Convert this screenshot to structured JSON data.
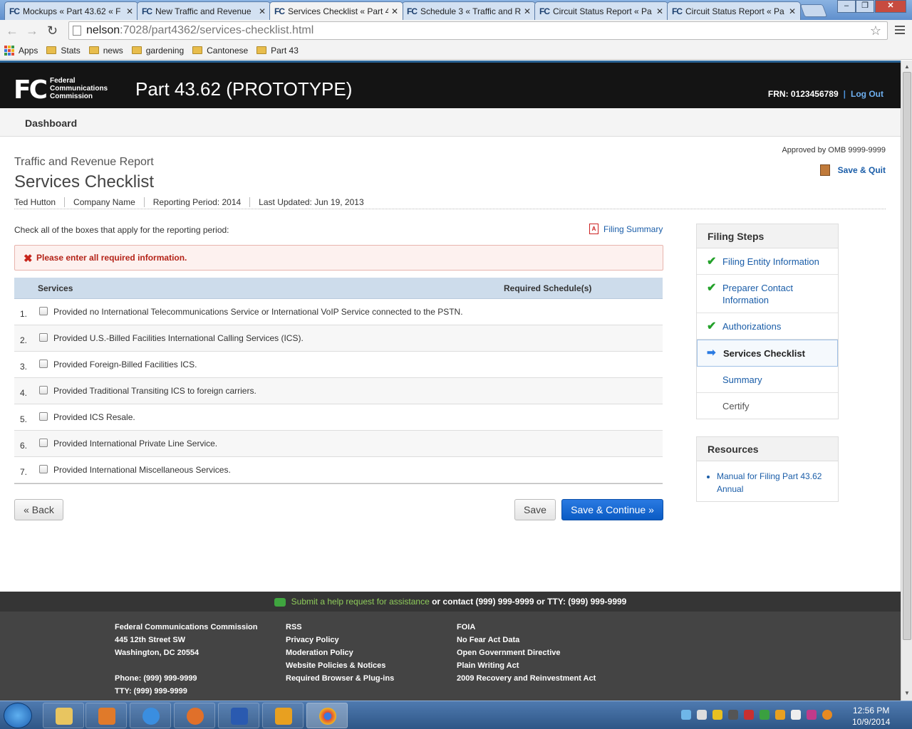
{
  "browser": {
    "tabs": [
      {
        "label": "Mockups « Part 43.62 « F",
        "favicon": "FC"
      },
      {
        "label": "New Traffic and Revenue",
        "favicon": "FC"
      },
      {
        "label": "Services Checklist « Part 4",
        "favicon": "FC"
      },
      {
        "label": "Schedule 3 « Traffic and R",
        "favicon": "FC"
      },
      {
        "label": "Circuit Status Report « Pa",
        "favicon": "FC"
      },
      {
        "label": "Circuit Status Report « Pa",
        "favicon": "FC"
      }
    ],
    "url_host": "nelson",
    "url_rest": ":7028/part4362/services-checklist.html",
    "bookmarks": [
      "Apps",
      "Stats",
      "news",
      "gardening",
      "Cantonese",
      "Part 43"
    ]
  },
  "header": {
    "logo": "FC",
    "agency_line1": "Federal",
    "agency_line2": "Communications",
    "agency_line3": "Commission",
    "title": "Part 43.62 (PROTOTYPE)",
    "frn": "FRN: 0123456789",
    "separator": "|",
    "logout": "Log Out"
  },
  "nav": {
    "dashboard": "Dashboard"
  },
  "page": {
    "omb": "Approved by OMB 9999-9999",
    "save_quit": "Save & Quit",
    "subtitle": "Traffic and Revenue Report",
    "title": "Services Checklist",
    "meta": [
      "Ted Hutton",
      "Company Name",
      "Reporting Period: 2014",
      "Last Updated: Jun 19, 2013"
    ],
    "instruction": "Check all of the boxes that apply for the reporting period:",
    "filing_summary": "Filing Summary",
    "error": "Please enter all required information.",
    "table_headers": {
      "services": "Services",
      "required": "Required Schedule(s)"
    },
    "services": [
      {
        "num": "1.",
        "text": "Provided no International Telecommunications Service or International VoIP Service connected to the PSTN."
      },
      {
        "num": "2.",
        "text": "Provided U.S.-Billed Facilities International Calling Services (ICS)."
      },
      {
        "num": "3.",
        "text": "Provided Foreign-Billed Facilities ICS."
      },
      {
        "num": "4.",
        "text": "Provided Traditional Transiting ICS to foreign carriers."
      },
      {
        "num": "5.",
        "text": "Provided ICS Resale."
      },
      {
        "num": "6.",
        "text": "Provided International Private Line Service."
      },
      {
        "num": "7.",
        "text": "Provided International Miscellaneous Services."
      }
    ],
    "back": "« Back",
    "save": "Save",
    "save_continue": "Save & Continue »"
  },
  "sidebar": {
    "steps_title": "Filing Steps",
    "steps": [
      {
        "label": "Filing Entity Information",
        "state": "done"
      },
      {
        "label": "Preparer Contact Information",
        "state": "done"
      },
      {
        "label": "Authorizations",
        "state": "done"
      },
      {
        "label": "Services Checklist",
        "state": "current"
      },
      {
        "label": "Summary",
        "state": "pending"
      },
      {
        "label": "Certify",
        "state": "disabled"
      }
    ],
    "resources_title": "Resources",
    "resources": [
      "Manual for Filing Part 43.62 Annual"
    ]
  },
  "footer": {
    "help_link": "Submit a help request for assistance",
    "help_rest": " or contact (999) 999-9999 or TTY: (999) 999-9999",
    "col1": [
      "Federal Communications Commission",
      "445 12th Street SW",
      "Washington, DC 20554",
      "",
      "Phone: (999) 999-9999",
      "TTY: (999) 999-9999"
    ],
    "col2": [
      "RSS",
      "Privacy Policy",
      "Moderation Policy",
      "Website Policies & Notices",
      "Required Browser & Plug-ins"
    ],
    "col3": [
      "FOIA",
      "No Fear Act Data",
      "Open Government Directive",
      "Plain Writing Act",
      "2009 Recovery and Reinvestment Act"
    ]
  },
  "taskbar": {
    "time": "12:56 PM",
    "date": "10/9/2014"
  },
  "colors": {
    "accent": "#0a5bc4",
    "header_bg": "#141414",
    "error": "#b42318",
    "check": "#23a12a"
  }
}
